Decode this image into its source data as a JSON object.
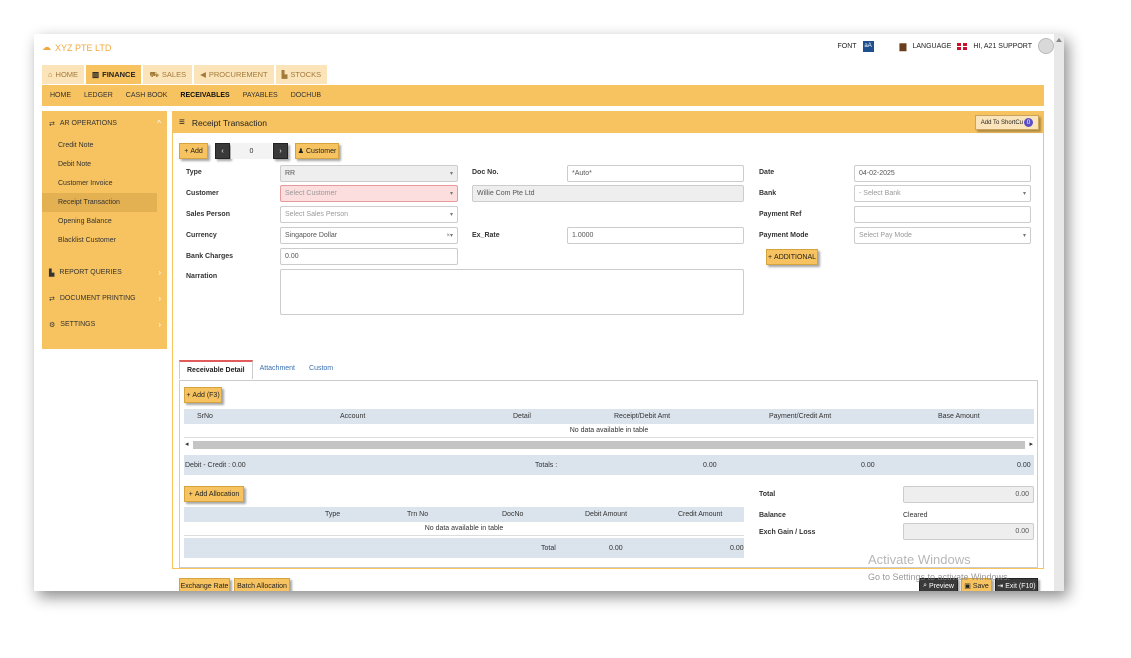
{
  "brand": "XYZ PTE LTD",
  "topbar": {
    "font_label": "FONT",
    "font_box": "aA",
    "language_label": "LANGUAGE",
    "user_greeting": "HI, A21 SUPPORT"
  },
  "main_tabs": [
    "HOME",
    "FINANCE",
    "SALES",
    "PROCUREMENT",
    "STOCKS"
  ],
  "sub_nav": [
    "HOME",
    "LEDGER",
    "CASH BOOK",
    "RECEIVABLES",
    "PAYABLES",
    "DOCHUB"
  ],
  "sidebar": {
    "ar_operations": "AR OPERATIONS",
    "items": [
      "Credit Note",
      "Debit Note",
      "Customer Invoice",
      "Receipt Transaction",
      "Opening Balance",
      "Blacklist Customer"
    ],
    "report_queries": "REPORT QUERIES",
    "document_printing": "DOCUMENT PRINTING",
    "settings": "SETTINGS"
  },
  "panel": {
    "title": "Receipt Transaction",
    "shortcut": "Add To ShortCu",
    "shortcut_badge": "0"
  },
  "toolbar": {
    "add": "Add",
    "record_no": "0",
    "customer": "Customer"
  },
  "form": {
    "type_label": "Type",
    "type_value": "RR",
    "customer_label": "Customer",
    "customer_placeholder": "Select Customer",
    "sales_person_label": "Sales Person",
    "sales_person_placeholder": "Select Sales Person",
    "currency_label": "Currency",
    "currency_value": "Singapore Dollar",
    "currency_clear": "×",
    "bank_charges_label": "Bank Charges",
    "bank_charges_value": "0.00",
    "narration_label": "Narration",
    "doc_no_label": "Doc No.",
    "doc_no_value": "*Auto*",
    "customer_name_value": "Willie Com Pte Ltd",
    "ex_rate_label": "Ex_Rate",
    "ex_rate_value": "1.0000",
    "date_label": "Date",
    "date_value": "04-02-2025",
    "bank_label": "Bank",
    "bank_placeholder": "- Select Bank",
    "payment_ref_label": "Payment Ref",
    "payment_mode_label": "Payment Mode",
    "payment_mode_placeholder": "Select Pay Mode",
    "additional": "ADDITIONAL"
  },
  "detail_tabs": [
    "Receivable Detail",
    "Attachment",
    "Custom"
  ],
  "receivable": {
    "add_button": "Add (F3)",
    "headers": [
      "SrNo",
      "Account",
      "Detail",
      "Receipt/Debit Amt",
      "Payment/Credit Amt",
      "Base Amount"
    ],
    "no_data": "No data available in table",
    "footer_label": "Debit - Credit : 0.00",
    "totals_label": "Totals :",
    "totals": [
      "0.00",
      "0.00",
      "0.00"
    ]
  },
  "allocation": {
    "add_button": "Add Allocation",
    "headers": [
      "Type",
      "Trn No",
      "DocNo",
      "Debit Amount",
      "Credit Amount"
    ],
    "no_data": "No data available in table",
    "total_label": "Total",
    "totals": [
      "0.00",
      "0.00"
    ]
  },
  "summary": {
    "total_label": "Total",
    "total_value": "0.00",
    "balance_label": "Balance",
    "balance_value": "Cleared",
    "exch_label": "Exch Gain / Loss",
    "exch_value": "0.00"
  },
  "bottom": {
    "exchange_rate": "Exchange Rate",
    "batch_allocation": "Batch Allocation",
    "preview": "Preview",
    "save": "Save",
    "exit": "Exit (F10)"
  },
  "watermark": {
    "line1": "Activate Windows",
    "line2": "Go to Settings to activate Windows."
  }
}
